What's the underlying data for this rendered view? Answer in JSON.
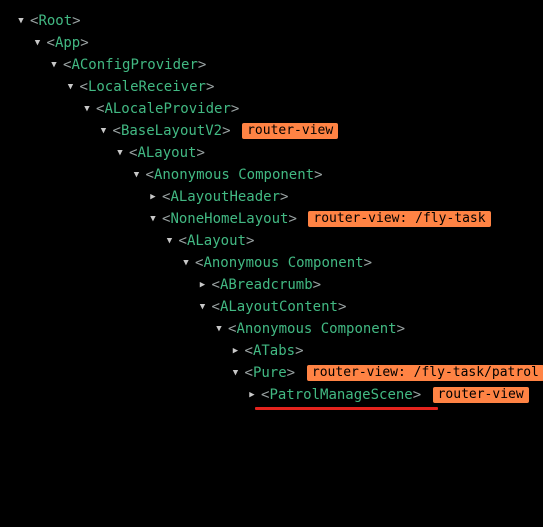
{
  "tree": {
    "nodes": [
      {
        "tag": "Root",
        "expanded": true,
        "badge": ""
      },
      {
        "tag": "App",
        "expanded": true,
        "badge": ""
      },
      {
        "tag": "AConfigProvider",
        "expanded": true,
        "badge": ""
      },
      {
        "tag": "LocaleReceiver",
        "expanded": true,
        "badge": ""
      },
      {
        "tag": "ALocaleProvider",
        "expanded": true,
        "badge": ""
      },
      {
        "tag": "BaseLayoutV2",
        "expanded": true,
        "badge": "router-view"
      },
      {
        "tag": "ALayout",
        "expanded": true,
        "badge": ""
      },
      {
        "tag": "Anonymous Component",
        "expanded": true,
        "badge": ""
      },
      {
        "tag": "ALayoutHeader",
        "expanded": false,
        "badge": ""
      },
      {
        "tag": "NoneHomeLayout",
        "expanded": true,
        "badge": "router-view: /fly-task"
      },
      {
        "tag": "ALayout",
        "expanded": true,
        "badge": ""
      },
      {
        "tag": "Anonymous Component",
        "expanded": true,
        "badge": ""
      },
      {
        "tag": "ABreadcrumb",
        "expanded": false,
        "badge": ""
      },
      {
        "tag": "ALayoutContent",
        "expanded": true,
        "badge": ""
      },
      {
        "tag": "Anonymous Component",
        "expanded": true,
        "badge": ""
      },
      {
        "tag": "ATabs",
        "expanded": false,
        "badge": ""
      },
      {
        "tag": "Pure",
        "expanded": true,
        "badge": "router-view: /fly-task/patrol"
      },
      {
        "tag": "PatrolManageScene",
        "expanded": false,
        "badge": "router-view"
      }
    ],
    "highlighted_node": "PatrolManageScene"
  },
  "colors": {
    "background": "#000000",
    "tag_name": "#42b983",
    "bracket": "#9aa3a3",
    "arrow": "#c8c8c8",
    "badge_bg": "#ff8344",
    "badge_text": "#000000",
    "highlight_underline": "#e4231d"
  },
  "icons": {
    "expanded": "caret-down-icon",
    "collapsed": "caret-right-icon"
  }
}
